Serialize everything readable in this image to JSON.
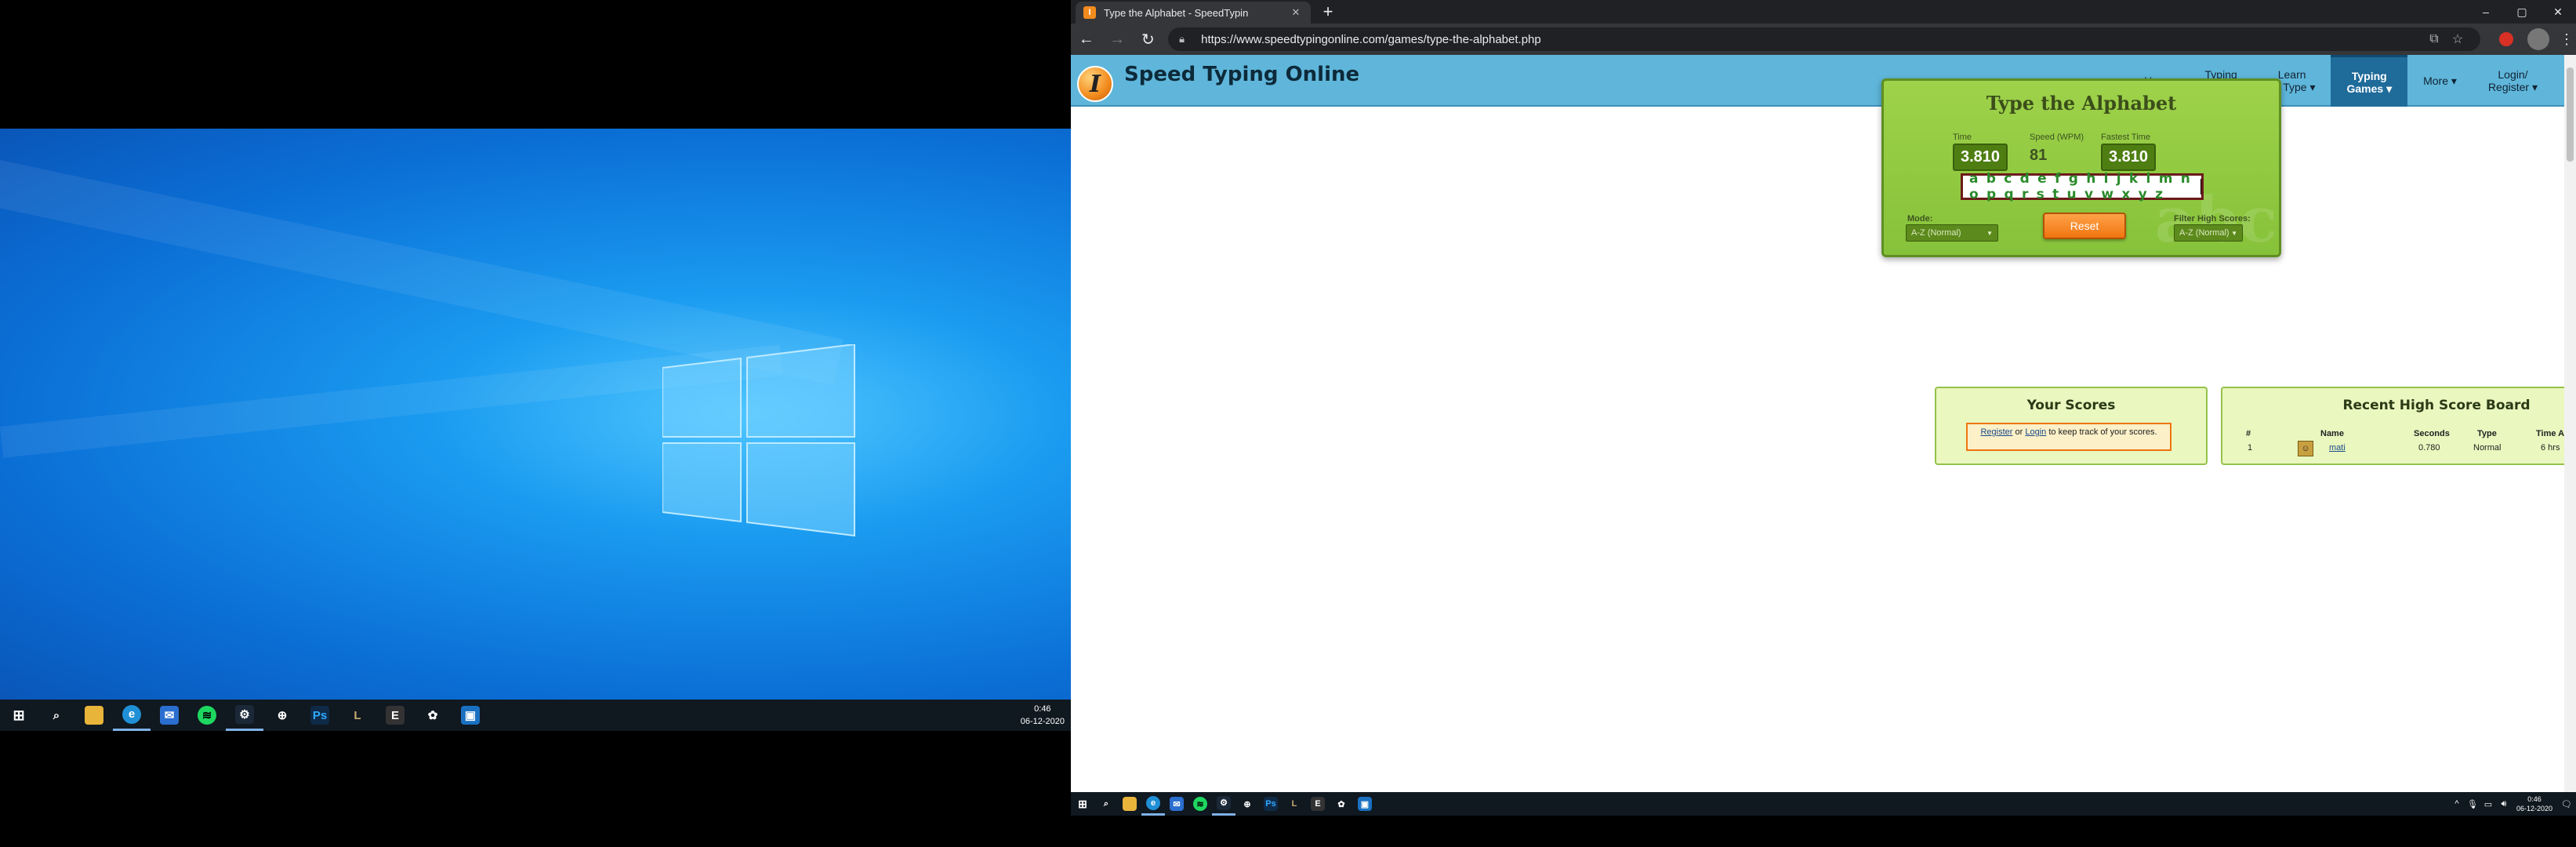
{
  "left_screen": {
    "taskbar": {
      "icons": [
        "start-icon",
        "search-icon",
        "file-explorer-icon",
        "edge-icon",
        "mail-icon",
        "spotify-icon",
        "steam-icon",
        "crosshair-icon",
        "photoshop-icon",
        "league-icon",
        "epic-icon",
        "settings-icon",
        "app-icon"
      ],
      "clock_time": "0:46",
      "clock_date": "06-12-2020"
    }
  },
  "browser": {
    "tab_title": "Type the Alphabet - SpeedTypin",
    "tab_favicon_letter": "I",
    "url": "https://www.speedtypingonline.com/games/type-the-alphabet.php",
    "window_controls": [
      "–",
      "▢",
      "✕"
    ]
  },
  "site": {
    "name": "Speed Typing Online",
    "logo_letter": "I",
    "nav": [
      {
        "label": "Home"
      },
      {
        "label": "Typing\nTest"
      },
      {
        "label": "Learn\nTo Type ▾"
      },
      {
        "label": "Typing\nGames ▾"
      },
      {
        "label": "More ▾"
      },
      {
        "label": "Login/\nRegister ▾"
      }
    ]
  },
  "game": {
    "title": "Type the Alphabet",
    "time_label": "Time",
    "time_value": "3.810",
    "speed_label": "Speed (WPM)",
    "speed_value": "81",
    "fastest_label": "Fastest Time",
    "fastest_value": "3.810",
    "typed_text": "a b c d e f g h i j k l m n o p q r s t u v w x y z",
    "mode_label": "Mode:",
    "mode_value": "A-Z (Normal)",
    "reset_label": "Reset",
    "filter_label": "Filter High Scores:",
    "filter_value": "A-Z (Normal)",
    "watermark": "abc"
  },
  "your_scores": {
    "title": "Your Scores",
    "register_link": "Register",
    "or_text": "or",
    "login_link": "Login",
    "note_text": "to keep track of your scores."
  },
  "high_scores": {
    "title": "Recent High Score Board",
    "columns": [
      "#",
      "Name",
      "Seconds",
      "Type",
      "Time Ago"
    ],
    "rows": [
      {
        "rank": "1",
        "name": "mati",
        "seconds": "0.780",
        "type": "Normal",
        "time_ago": "6 hrs"
      }
    ]
  },
  "right_taskbar": {
    "clock_time": "0:46",
    "clock_date": "06-12-2020"
  }
}
